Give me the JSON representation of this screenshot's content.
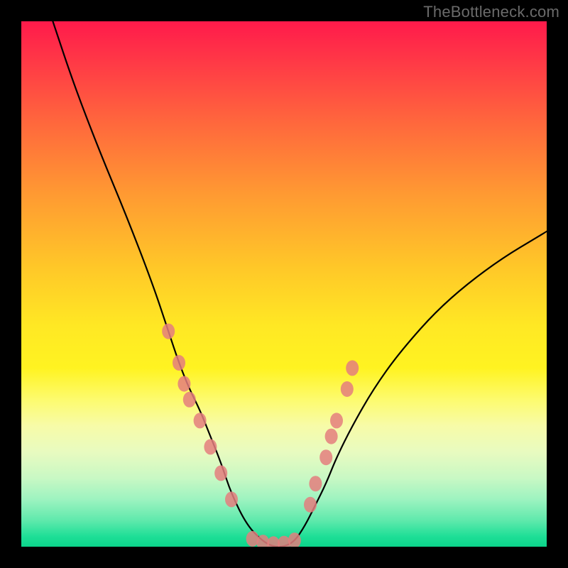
{
  "watermark": "TheBottleneck.com",
  "chart_data": {
    "type": "line",
    "title": "",
    "xlabel": "",
    "ylabel": "",
    "xlim": [
      0,
      100
    ],
    "ylim": [
      0,
      100
    ],
    "grid": false,
    "legend": false,
    "background_gradient_meaning": "bottleneck severity (red=high, green=low)",
    "series": [
      {
        "name": "bottleneck-curve",
        "note": "V-shaped curve; y≈100 is worst (red), y≈0 is best (green). Minimum plateau near x≈45–52.",
        "x": [
          6,
          10,
          15,
          20,
          25,
          28,
          30,
          32,
          34,
          36,
          38,
          40,
          43,
          46,
          48,
          50,
          52,
          54,
          56,
          58,
          60,
          63,
          67,
          72,
          80,
          90,
          100
        ],
        "values": [
          100,
          88,
          75,
          63,
          50,
          41,
          35,
          30,
          26,
          21,
          16,
          10,
          4,
          1,
          0,
          0,
          1,
          4,
          8,
          12,
          17,
          23,
          30,
          37,
          46,
          54,
          60
        ]
      }
    ],
    "markers": [
      {
        "name": "left-cluster",
        "color": "#e47e7e",
        "points": [
          {
            "x": 28,
            "y": 41
          },
          {
            "x": 30,
            "y": 35
          },
          {
            "x": 31,
            "y": 31
          },
          {
            "x": 32,
            "y": 28
          },
          {
            "x": 34,
            "y": 24
          },
          {
            "x": 36,
            "y": 19
          },
          {
            "x": 38,
            "y": 14
          },
          {
            "x": 40,
            "y": 9
          }
        ]
      },
      {
        "name": "bottom-plateau",
        "color": "#e47e7e",
        "points": [
          {
            "x": 44,
            "y": 1.5
          },
          {
            "x": 46,
            "y": 0.8
          },
          {
            "x": 48,
            "y": 0.5
          },
          {
            "x": 50,
            "y": 0.6
          },
          {
            "x": 52,
            "y": 1.2
          }
        ]
      },
      {
        "name": "right-cluster",
        "color": "#e47e7e",
        "points": [
          {
            "x": 55,
            "y": 8
          },
          {
            "x": 56,
            "y": 12
          },
          {
            "x": 58,
            "y": 17
          },
          {
            "x": 59,
            "y": 21
          },
          {
            "x": 60,
            "y": 24
          },
          {
            "x": 62,
            "y": 30
          },
          {
            "x": 63,
            "y": 34
          }
        ]
      }
    ]
  }
}
